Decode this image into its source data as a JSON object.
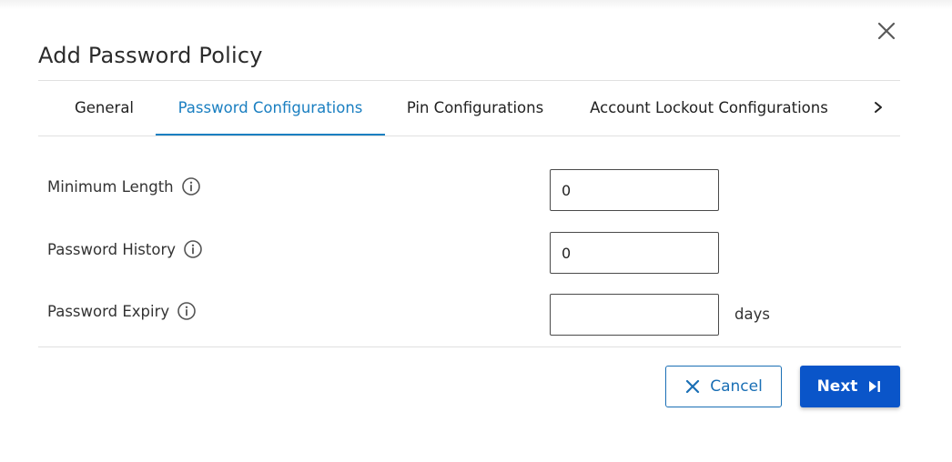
{
  "dialog": {
    "title": "Add Password Policy"
  },
  "tabs": [
    {
      "label": "General",
      "active": false
    },
    {
      "label": "Password Configurations",
      "active": true
    },
    {
      "label": "Pin Configurations",
      "active": false
    },
    {
      "label": "Account Lockout Configurations",
      "active": false
    }
  ],
  "fields": {
    "min_length": {
      "label": "Minimum Length",
      "value": "0"
    },
    "history": {
      "label": "Password History",
      "value": "0"
    },
    "expiry": {
      "label": "Password Expiry",
      "value": "",
      "suffix": "days"
    }
  },
  "buttons": {
    "cancel": "Cancel",
    "next": "Next"
  },
  "icons": {
    "close": "close-icon",
    "tab_scroll": "chevron-right-icon",
    "info": "info-icon",
    "cancel": "x-icon",
    "next": "skip-next-icon"
  },
  "colors": {
    "accent": "#1a7fc1",
    "primary_button": "#0a55c9"
  }
}
